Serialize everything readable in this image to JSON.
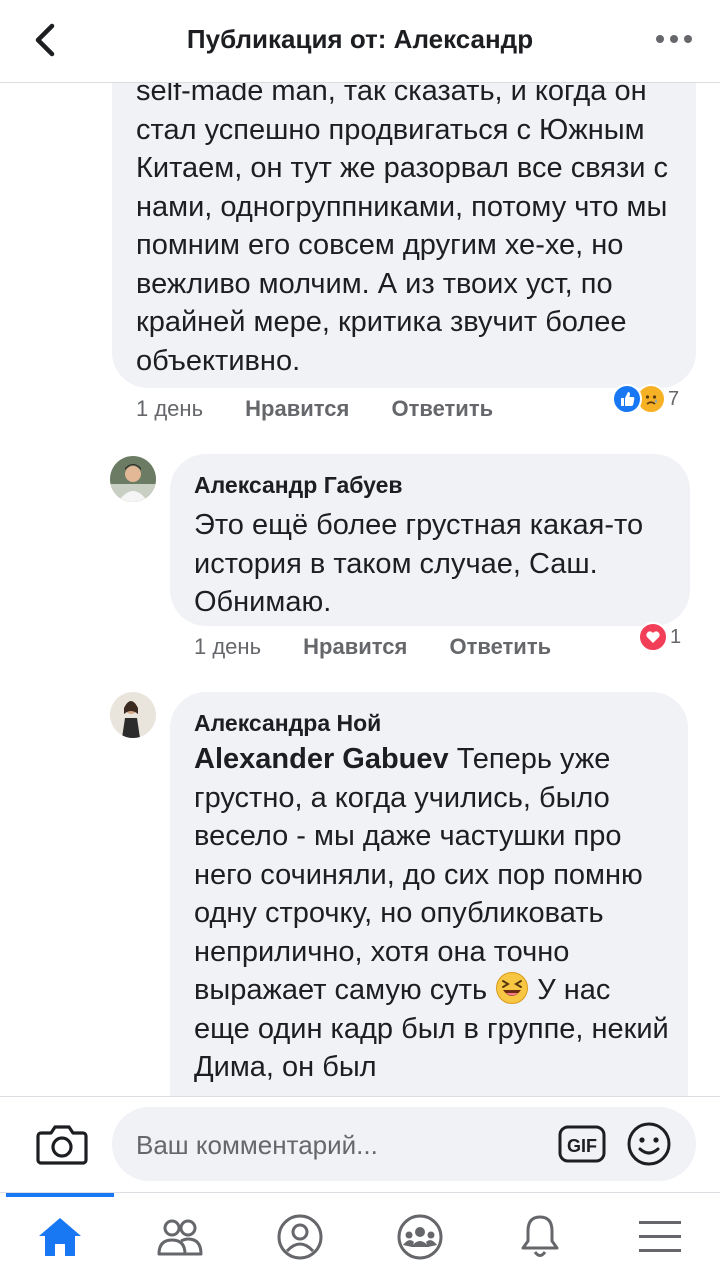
{
  "header": {
    "title": "Публикация от: Александр"
  },
  "comments": [
    {
      "text": "self-made man, так сказать, и когда он стал успешно продвигаться с Южным Китаем, он тут же разорвал все связи с нами, одногруппниками, потому что мы помним его совсем другим хе-хе, но вежливо молчим. А из твоих уст, по крайней мере, критика звучит более объективно.",
      "time": "1 день",
      "like_label": "Нравится",
      "reply_label": "Ответить",
      "reaction_icons": [
        "like-icon",
        "sad-icon"
      ],
      "reaction_count": "7"
    },
    {
      "author": "Александр Габуев",
      "text": "Это ещё более грустная какая-то история в таком случае, Саш. Обнимаю.",
      "time": "1 день",
      "like_label": "Нравится",
      "reply_label": "Ответить",
      "reaction_icons": [
        "love-icon"
      ],
      "reaction_count": "1"
    },
    {
      "author": "Александра Ной",
      "mention": "Alexander Gabuev",
      "text": " Теперь уже грустно, а когда учились, было весело - мы даже частушки про него сочиняли, до сих пор помню одну строчку, но опубликовать неприлично, хотя она точно выражает самую суть",
      "emoji": "laughing-emoji",
      "text2": " У нас еще один кадр был в группе, некий Дима, он был"
    }
  ],
  "composer": {
    "placeholder": "Ваш комментарий...",
    "gif_label": "GIF"
  },
  "nav": {
    "items": [
      "home-icon",
      "friends-icon",
      "profile-icon",
      "groups-icon",
      "notifications-icon",
      "menu-icon"
    ],
    "active": "home-icon"
  },
  "colors": {
    "accent": "#1877f2",
    "bubble": "#f0f2f5",
    "love": "#f33e58",
    "sad": "#f7b125"
  }
}
